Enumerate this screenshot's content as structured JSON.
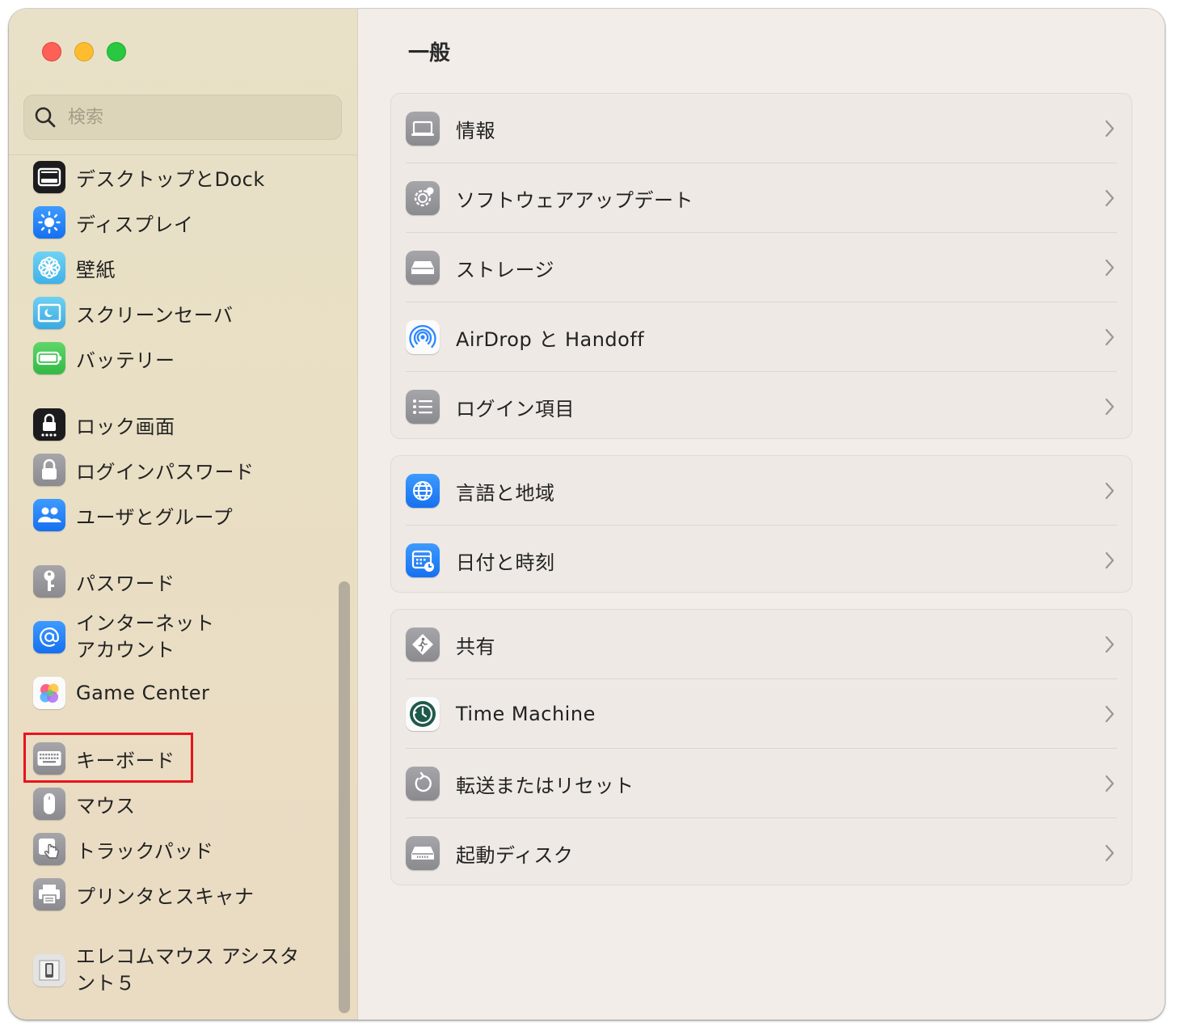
{
  "sidebar": {
    "search_placeholder": "検索",
    "items": [
      {
        "label": "デスクトップとDock",
        "icon": "dock-icon"
      },
      {
        "label": "ディスプレイ",
        "icon": "display-brightness-icon"
      },
      {
        "label": "壁紙",
        "icon": "wallpaper-flower-icon"
      },
      {
        "label": "スクリーンセーバ",
        "icon": "screensaver-icon"
      },
      {
        "label": "バッテリー",
        "icon": "battery-icon"
      },
      {
        "label": "ロック画面",
        "icon": "lock-screen-icon"
      },
      {
        "label": "ログインパスワード",
        "icon": "padlock-icon"
      },
      {
        "label": "ユーザとグループ",
        "icon": "users-icon"
      },
      {
        "label": "パスワード",
        "icon": "key-icon"
      },
      {
        "label": "インターネット\nアカウント",
        "icon": "at-sign-icon"
      },
      {
        "label": "Game Center",
        "icon": "game-center-icon"
      },
      {
        "label": "キーボード",
        "icon": "keyboard-icon"
      },
      {
        "label": "マウス",
        "icon": "mouse-icon"
      },
      {
        "label": "トラックパッド",
        "icon": "trackpad-icon"
      },
      {
        "label": "プリンタとスキャナ",
        "icon": "printer-icon"
      },
      {
        "label": "エレコムマウス アシスタント５",
        "icon": "elecom-mouse-icon"
      }
    ]
  },
  "main": {
    "title": "一般",
    "groups": [
      [
        {
          "label": "情報",
          "icon": "laptop-icon"
        },
        {
          "label": "ソフトウェアアップデート",
          "icon": "gear-update-icon"
        },
        {
          "label": "ストレージ",
          "icon": "drive-icon"
        },
        {
          "label": "AirDrop と Handoff",
          "icon": "airdrop-icon"
        },
        {
          "label": "ログイン項目",
          "icon": "list-icon"
        }
      ],
      [
        {
          "label": "言語と地域",
          "icon": "globe-icon"
        },
        {
          "label": "日付と時刻",
          "icon": "calendar-clock-icon"
        }
      ],
      [
        {
          "label": "共有",
          "icon": "sharing-icon"
        },
        {
          "label": "Time Machine",
          "icon": "time-machine-icon"
        },
        {
          "label": "転送またはリセット",
          "icon": "reset-icon"
        },
        {
          "label": "起動ディスク",
          "icon": "startup-disk-icon"
        }
      ]
    ]
  },
  "colors": {
    "highlight_box": "#e8141d",
    "accent_blue": "#1670f0"
  }
}
